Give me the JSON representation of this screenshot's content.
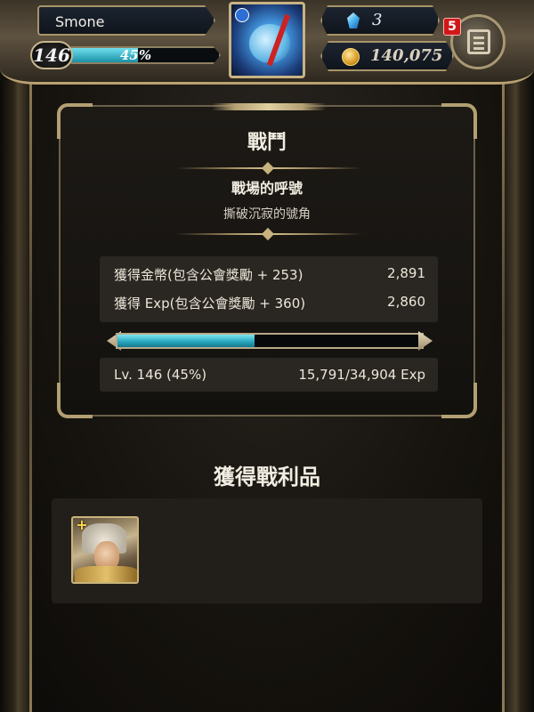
{
  "player": {
    "name": "Smone",
    "level": "146",
    "exp_percent_label": "45%",
    "exp_fraction": 0.45
  },
  "currency": {
    "gems": "3",
    "coins": "140,075"
  },
  "notifications": {
    "count": "5"
  },
  "battle": {
    "title": "戰鬥",
    "quest_title": "戰場的呼號",
    "quest_subtitle": "撕破沉寂的號角",
    "rewards": [
      {
        "label": "獲得金幣(包含公會獎勵 + 253)",
        "value": "2,891"
      },
      {
        "label": "獲得 Exp(包含公會獎勵 + 360)",
        "value": "2,860"
      }
    ],
    "exp_bar_fraction": 0.45,
    "level_text": "Lv. 146 (45%)",
    "exp_text": "15,791/34,904 Exp"
  },
  "loot": {
    "title": "獲得戰利品",
    "items": [
      {
        "icon": "knight-character-card",
        "plus_badge": "+"
      }
    ]
  },
  "colors": {
    "accent_gold": "#b39f72",
    "exp_cyan": "#2aa8bf",
    "notification_red": "#d01818"
  }
}
